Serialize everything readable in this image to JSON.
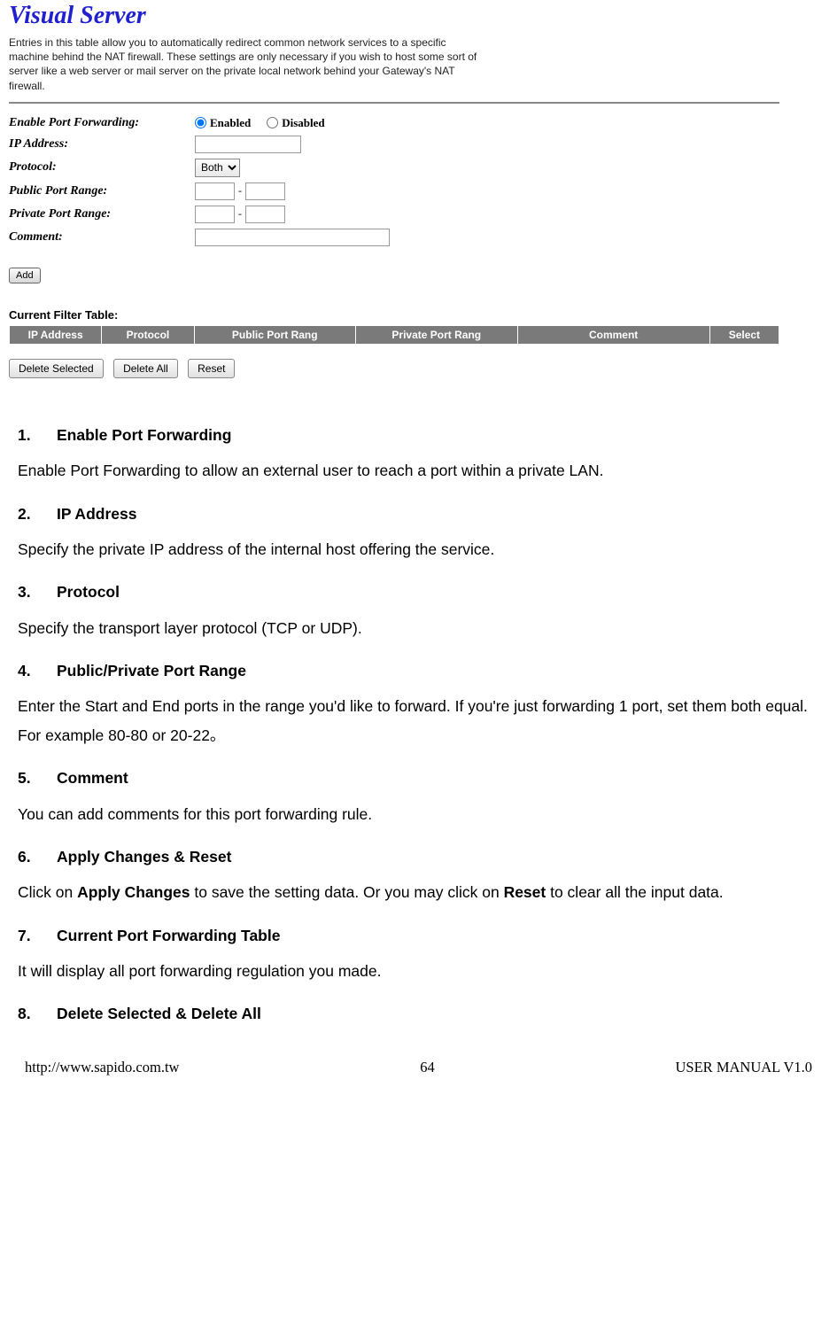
{
  "router": {
    "title": "Visual Server",
    "intro": "Entries in this table allow you to automatically redirect common network services to a specific machine behind the NAT firewall. These settings are only necessary if you wish to host some sort of server like a web server or mail server on the private local network behind your Gateway's NAT firewall.",
    "labels": {
      "enable": "Enable Port Forwarding:",
      "ip": "IP Address:",
      "protocol": "Protocol:",
      "public_range": "Public Port Range:",
      "private_range": "Private Port Range:",
      "comment": "Comment:"
    },
    "radio_enabled": "Enabled",
    "radio_disabled": "Disabled",
    "protocol_value": "Both",
    "add_btn": "Add",
    "table_title": "Current Filter Table:",
    "headers": [
      "IP Address",
      "Protocol",
      "Public Port Rang",
      "Private Port Rang",
      "Comment",
      "Select"
    ],
    "btn_delete_selected": "Delete Selected",
    "btn_delete_all": "Delete All",
    "btn_reset": "Reset"
  },
  "doc": {
    "items": [
      {
        "num": "1.",
        "title": "Enable Port Forwarding",
        "desc": "Enable Port Forwarding to allow an external user to reach a port within a private LAN."
      },
      {
        "num": "2.",
        "title": "IP Address",
        "desc": "Specify the private IP address of the internal host offering the service."
      },
      {
        "num": "3.",
        "title": "Protocol",
        "desc": "Specify the transport layer protocol (TCP or UDP)."
      },
      {
        "num": "4.",
        "title": "Public/Private Port Range",
        "desc": "Enter the Start and End ports in the range you'd like to forward. If you're just forwarding 1 port, set them both equal. For example 80-80 or 20-22。"
      },
      {
        "num": "5.",
        "title": "Comment",
        "desc": "You can add comments for this port forwarding rule."
      },
      {
        "num": "6.",
        "title": "Apply Changes & Reset",
        "desc_html": "Click on <b>Apply Changes</b> to save the setting data. Or you may click on <b>Reset</b> to clear all the input data."
      },
      {
        "num": "7.",
        "title": "Current Port Forwarding Table",
        "desc": "It will display all port forwarding regulation you made."
      },
      {
        "num": "8.",
        "title": "Delete Selected & Delete All",
        "desc": ""
      }
    ]
  },
  "footer": {
    "left": "http://www.sapido.com.tw",
    "center": "64",
    "right": "USER MANUAL V1.0"
  }
}
